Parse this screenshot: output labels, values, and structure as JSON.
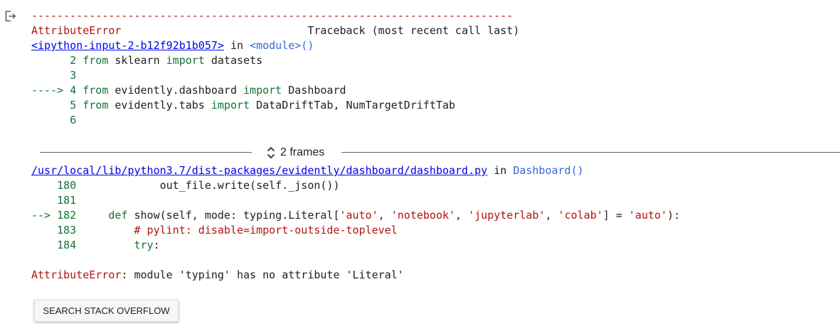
{
  "output": {
    "icon": "output-arrow-icon"
  },
  "traceback_header": {
    "rule": "---------------------------------------------------------------------------",
    "error_name": "AttributeError",
    "spacer": "                             ",
    "traceback_label": "Traceback (most recent call last)"
  },
  "frame1": {
    "source_link": "<ipython-input-2-b12f92b1b057>",
    "in_word": " in ",
    "function": "<module>()",
    "lines": [
      {
        "prefix": "      ",
        "num": "2",
        "sp": " ",
        "kw1": "from",
        "rest1": " sklearn ",
        "kw2": "import",
        "rest2": " datasets"
      },
      {
        "prefix": "      ",
        "num": "3",
        "sp": "",
        "kw1": "",
        "rest1": "",
        "kw2": "",
        "rest2": ""
      },
      {
        "prefix": "----> ",
        "num": "4",
        "sp": " ",
        "kw1": "from",
        "rest1": " evidently.dashboard ",
        "kw2": "import",
        "rest2": " Dashboard"
      },
      {
        "prefix": "      ",
        "num": "5",
        "sp": " ",
        "kw1": "from",
        "rest1": " evidently.tabs ",
        "kw2": "import",
        "rest2": " DataDriftTab, NumTargetDriftTab"
      },
      {
        "prefix": "      ",
        "num": "6",
        "sp": "",
        "kw1": "",
        "rest1": "",
        "kw2": "",
        "rest2": ""
      }
    ]
  },
  "frames_toggle": {
    "label": "2 frames",
    "icon": "unfold-icon"
  },
  "frame2": {
    "source_link": "/usr/local/lib/python3.7/dist-packages/evidently/dashboard/dashboard.py",
    "in_word": " in ",
    "function": "Dashboard()",
    "line180": {
      "prefix": "    ",
      "num": "180",
      "code": "             out_file.write(self._json())"
    },
    "line181": {
      "prefix": "    ",
      "num": "181"
    },
    "line182": {
      "prefix": "--> ",
      "num": "182",
      "indent": "     ",
      "kw": "def",
      "sig": " show(self, mode: typing.Literal[",
      "s1": "'auto'",
      "c1": ", ",
      "s2": "'notebook'",
      "c2": ", ",
      "s3": "'jupyterlab'",
      "c3": ", ",
      "s4": "'colab'",
      "c4": "] = ",
      "s5": "'auto'",
      "end": "):"
    },
    "line183": {
      "prefix": "    ",
      "num": "183",
      "indent": "         ",
      "comment": "# pylint: disable=import-outside-toplevel"
    },
    "line184": {
      "prefix": "    ",
      "num": "184",
      "indent": "         ",
      "kw": "try",
      "end": ":"
    }
  },
  "error": {
    "name": "AttributeError",
    "message": ": module 'typing' has no attribute 'Literal'"
  },
  "search_button": {
    "label": "SEARCH STACK OVERFLOW"
  }
}
